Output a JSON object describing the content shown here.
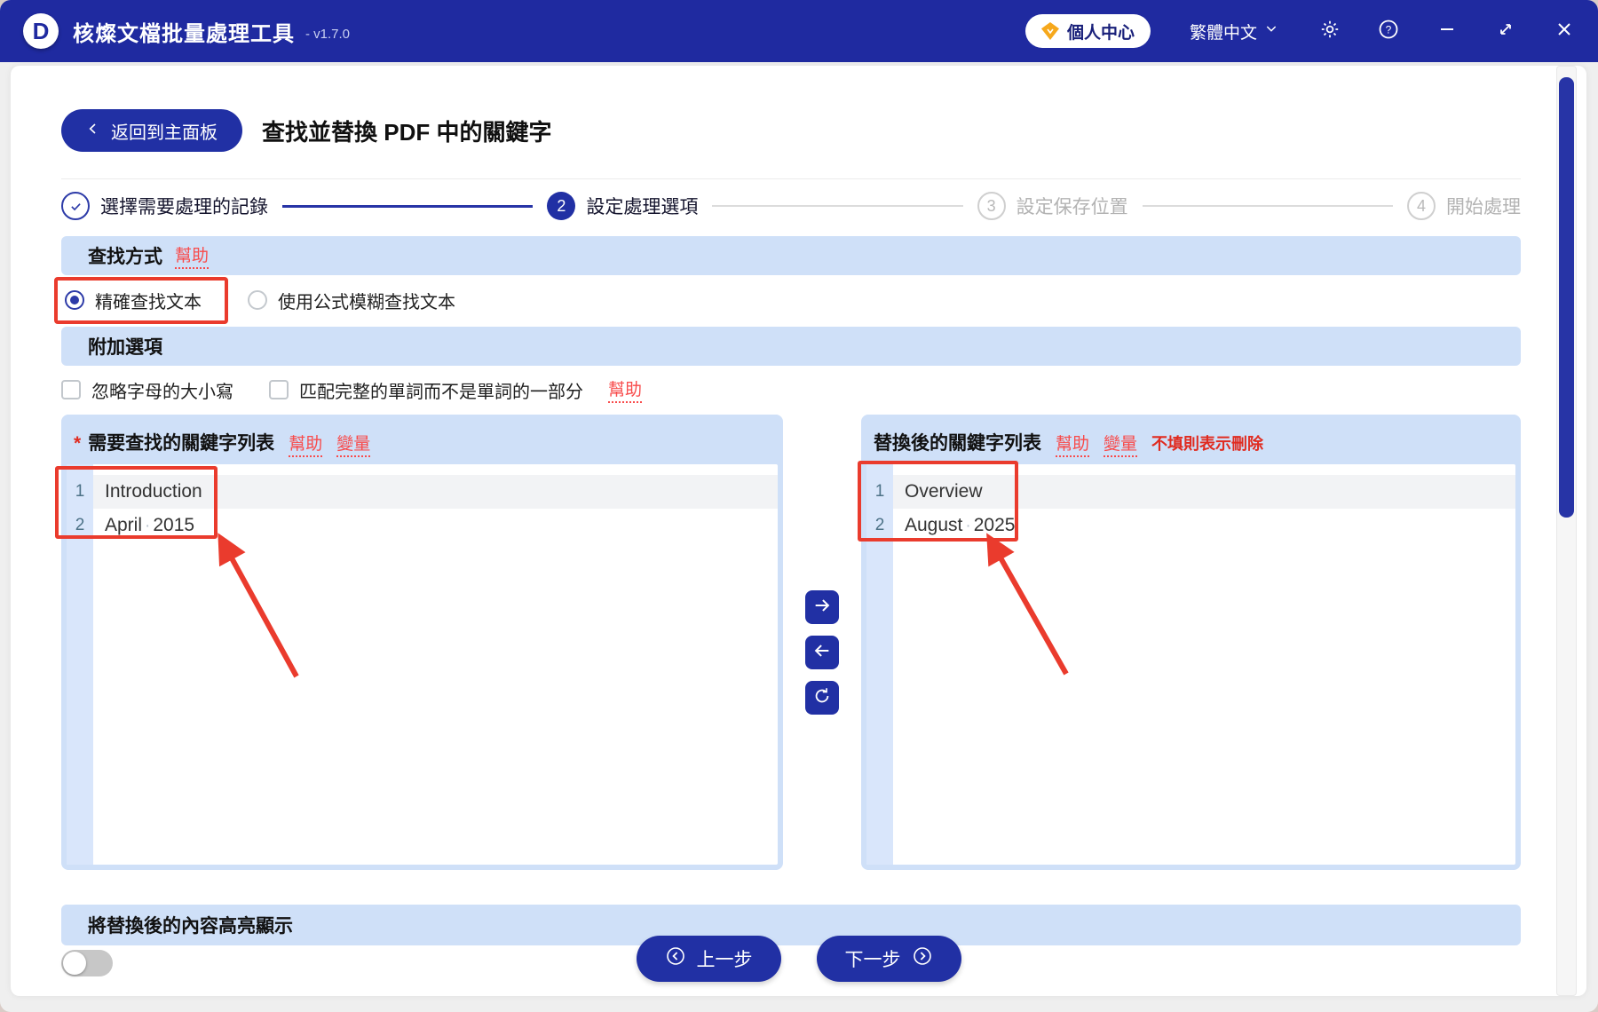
{
  "titlebar": {
    "logo_letter": "D",
    "app_name": "核燦文檔批量處理工具",
    "version": "- v1.7.0",
    "user_center_label": "個人中心",
    "language_label": "繁體中文"
  },
  "header": {
    "back_label": "返回到主面板",
    "page_title": "查找並替換 PDF 中的關鍵字"
  },
  "steps": {
    "step1": {
      "label": "選擇需要處理的記錄",
      "state": "done"
    },
    "step2": {
      "number": "2",
      "label": "設定處理選項",
      "state": "active"
    },
    "step3": {
      "number": "3",
      "label": "設定保存位置",
      "state": "pending"
    },
    "step4": {
      "number": "4",
      "label": "開始處理",
      "state": "pending"
    }
  },
  "search_mode": {
    "heading": "查找方式",
    "help_link": "幫助",
    "option_exact": "精確查找文本",
    "option_exact_selected": true,
    "option_fuzzy": "使用公式模糊查找文本",
    "option_fuzzy_selected": false
  },
  "additional_options": {
    "heading": "附加選項",
    "ignore_case_label": "忽略字母的大小寫",
    "ignore_case_checked": false,
    "whole_word_label": "匹配完整的單詞而不是單詞的一部分",
    "whole_word_checked": false,
    "help_link": "幫助"
  },
  "find_panel": {
    "required_mark": "*",
    "title": "需要查找的關鍵字列表",
    "help_link": "幫助",
    "variable_link": "變量",
    "space_marker": "·",
    "rows": [
      {
        "num": "1",
        "text": "Introduction"
      },
      {
        "num": "2",
        "parts": [
          "April",
          "2015"
        ]
      }
    ]
  },
  "replace_panel": {
    "title": "替換後的關鍵字列表",
    "help_link": "幫助",
    "variable_link": "變量",
    "note": "不填則表示刪除",
    "space_marker": "·",
    "rows": [
      {
        "num": "1",
        "text": "Overview"
      },
      {
        "num": "2",
        "parts": [
          "August",
          "2025"
        ]
      }
    ]
  },
  "footer": {
    "highlight_heading": "將替換後的內容高亮顯示",
    "highlight_toggle_on": false,
    "prev_label": "上一步",
    "next_label": "下一步"
  },
  "colors": {
    "titlebar_blue": "#1f2aa0",
    "primary_blue": "#2130a4",
    "section_blue": "#cfe0f8",
    "gutter_blue": "#d9e6fb",
    "row_alt_gray": "#f2f3f5",
    "annotation_red": "#ea3b2d",
    "link_red": "#f84b4b",
    "note_red": "#e02b20",
    "scrollbar_thumb_blue": "#2734a6",
    "toggle_off_gray": "#c7c7c7",
    "gem_orange": "#f6a81c"
  }
}
